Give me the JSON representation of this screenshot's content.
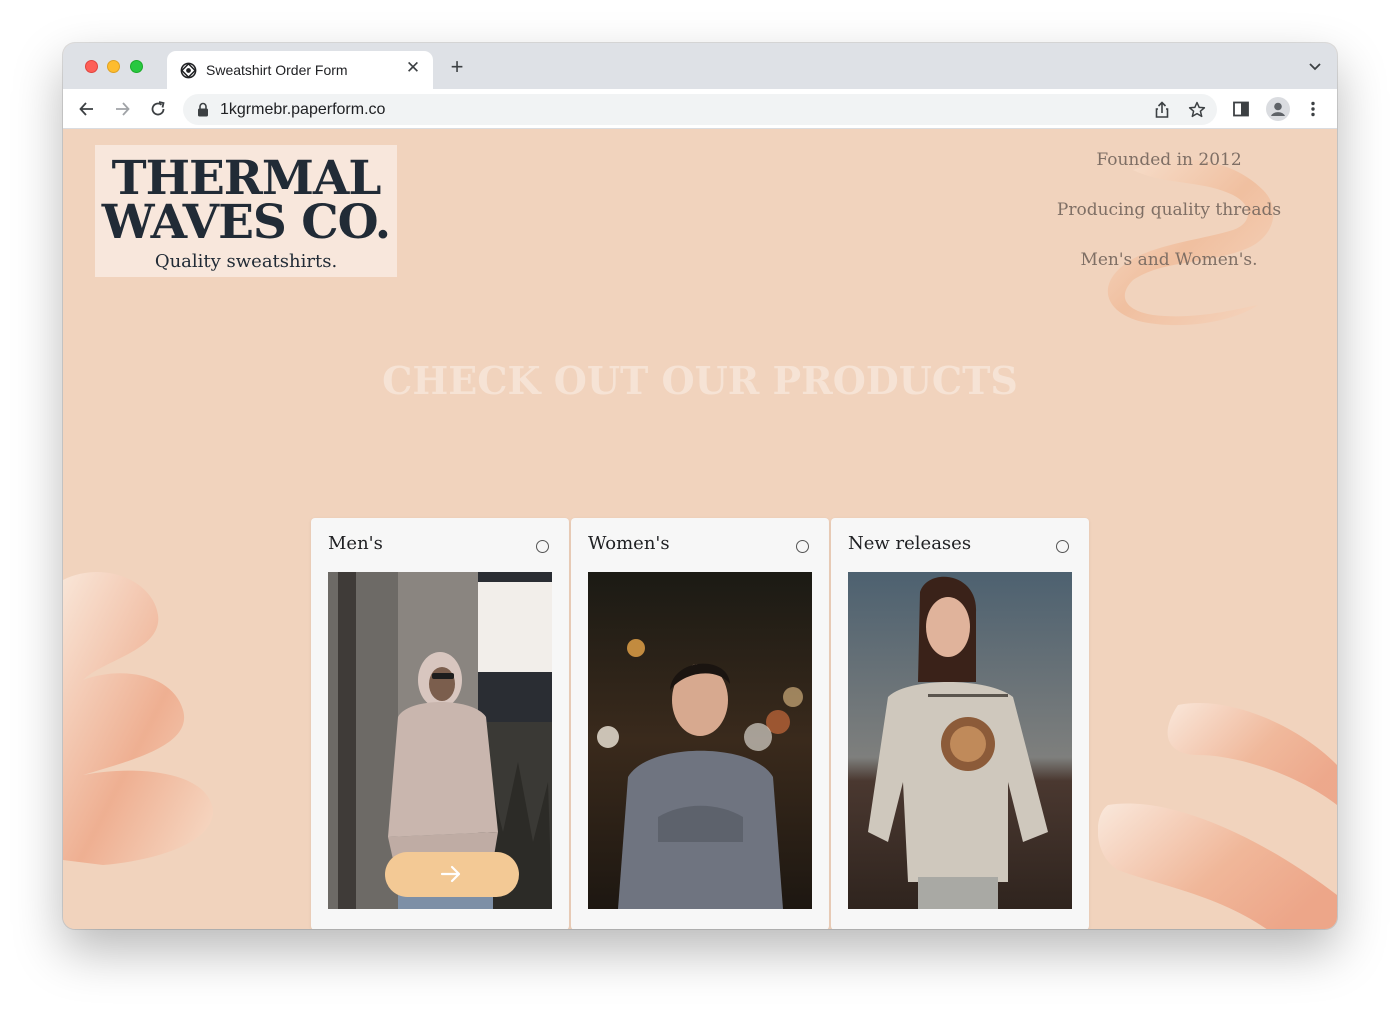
{
  "browser": {
    "tab_title": "Sweatshirt Order Form",
    "url": "1kgrmebr.paperform.co"
  },
  "logo": {
    "line1": "THERMAL",
    "line2": "WAVES CO.",
    "tagline": "Quality sweatshirts."
  },
  "facts": [
    "Founded in 2012",
    "Producing quality threads",
    "Men's and Women's."
  ],
  "heading": "CHECK OUT OUR PRODUCTS",
  "cards": [
    {
      "label": "Men's",
      "selected": false
    },
    {
      "label": "Women's",
      "selected": false
    },
    {
      "label": "New releases",
      "selected": false
    }
  ],
  "colors": {
    "page_bg": "#f1d3bd",
    "logo_bg": "#f8e7dc",
    "heading": "#f6e3d5",
    "button": "#f3c995"
  }
}
